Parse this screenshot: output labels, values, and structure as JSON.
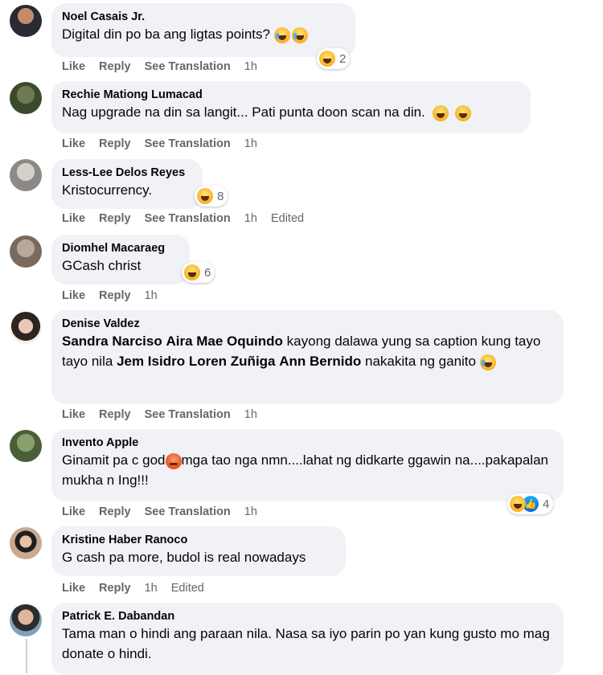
{
  "comments": [
    {
      "author": "Noel Casais Jr.",
      "text": "Digital din po ba ang ligtas points?",
      "actions": {
        "like": "Like",
        "reply": "Reply",
        "see_translation": "See Translation",
        "time": "1h"
      },
      "reactions": {
        "icons": [
          "haha-icon"
        ],
        "count": "2"
      }
    },
    {
      "author": "Rechie Mationg Lumacad",
      "text": "Nag upgrade na din sa langit... Pati punta doon scan na din.",
      "actions": {
        "like": "Like",
        "reply": "Reply",
        "see_translation": "See Translation",
        "time": "1h"
      }
    },
    {
      "author": "Less-Lee Delos Reyes",
      "text": "Kristocurrency.",
      "actions": {
        "like": "Like",
        "reply": "Reply",
        "see_translation": "See Translation",
        "time": "1h",
        "edited": "Edited"
      },
      "reactions": {
        "icons": [
          "haha-icon"
        ],
        "count": "8"
      }
    },
    {
      "author": "Diomhel Macaraeg",
      "text": "GCash christ",
      "actions": {
        "like": "Like",
        "reply": "Reply",
        "time": "1h"
      },
      "reactions": {
        "icons": [
          "haha-icon"
        ],
        "count": "6"
      }
    },
    {
      "author": "Denise Valdez",
      "mention1": "Sandra Narciso",
      "mention2": "Aira Mae Oquindo",
      "text_part1": "kayong dalawa yung sa caption kung tayo tayo nila",
      "mention3": "Jem Isidro",
      "mention4": "Loren Zuñiga",
      "mention5": "Ann Bernido",
      "text_part2": "nakakita ng ganito",
      "actions": {
        "like": "Like",
        "reply": "Reply",
        "see_translation": "See Translation",
        "time": "1h"
      }
    },
    {
      "author": "Invento Apple",
      "text_part1": "Ginamit pa c god",
      "text_part2": "mga tao nga nmn....lahat ng didkarte ggawin na....pakapalan mukha n Ing!!!",
      "actions": {
        "like": "Like",
        "reply": "Reply",
        "see_translation": "See Translation",
        "time": "1h"
      },
      "reactions": {
        "icons": [
          "haha-icon",
          "like-icon"
        ],
        "count": "4"
      }
    },
    {
      "author": "Kristine Haber Ranoco",
      "text": "G cash pa more, budol is real nowadays",
      "actions": {
        "like": "Like",
        "reply": "Reply",
        "time": "1h",
        "edited": "Edited"
      }
    },
    {
      "author": "Patrick E. Dabandan",
      "text": "Tama man o hindi ang paraan nila. Nasa sa iyo parin po yan kung gusto mo mag donate o hindi."
    }
  ],
  "colors": {
    "bubble": "#f0f2f5",
    "secondary_text": "#65676b",
    "like_blue": "#1877f2"
  }
}
